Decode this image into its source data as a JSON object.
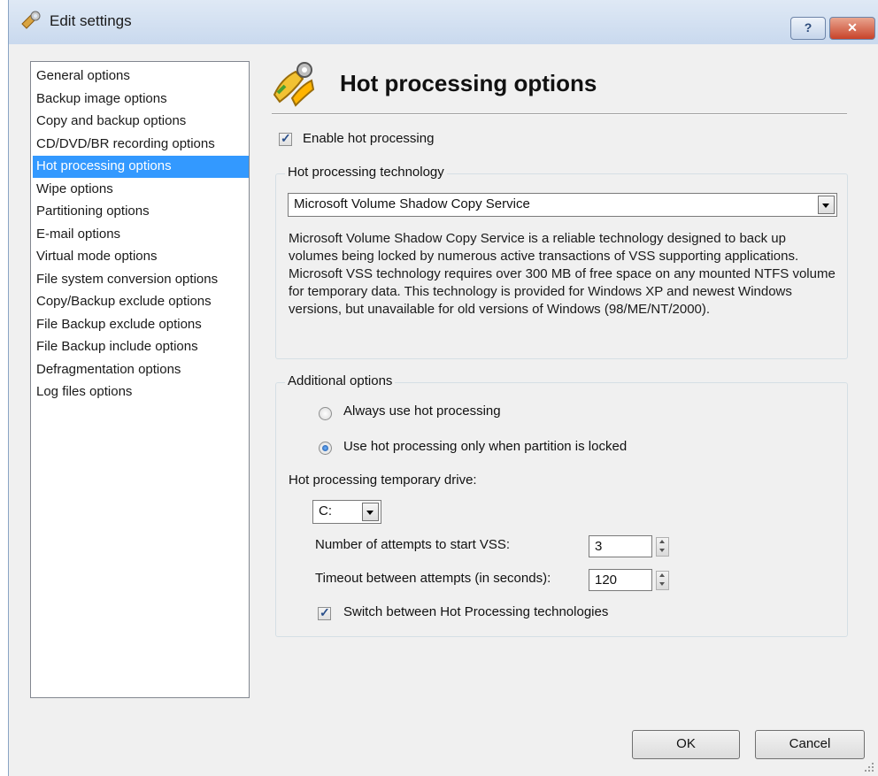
{
  "window": {
    "title": "Edit settings",
    "help_label": "?",
    "close_label": "✕"
  },
  "sidebar": {
    "items": [
      {
        "label": "General options"
      },
      {
        "label": "Backup image options"
      },
      {
        "label": "Copy and backup options"
      },
      {
        "label": "CD/DVD/BR recording options"
      },
      {
        "label": "Hot processing options",
        "selected": true
      },
      {
        "label": "Wipe options"
      },
      {
        "label": "Partitioning options"
      },
      {
        "label": "E-mail options"
      },
      {
        "label": "Virtual mode options"
      },
      {
        "label": "File system conversion options"
      },
      {
        "label": "Copy/Backup exclude options"
      },
      {
        "label": "File Backup exclude options"
      },
      {
        "label": "File Backup include options"
      },
      {
        "label": "Defragmentation options"
      },
      {
        "label": "Log files options"
      }
    ]
  },
  "panel": {
    "title": "Hot processing options",
    "enable_label": "Enable hot processing",
    "enable_checked": true,
    "technology": {
      "group_label": "Hot processing technology",
      "selected": "Microsoft Volume Shadow Copy Service",
      "description": "Microsoft Volume Shadow Copy Service is a reliable technology designed to back up volumes being locked by numerous active transactions of VSS supporting applications. Microsoft VSS technology requires over 300 MB of free space on any mounted NTFS volume for temporary data. This technology is provided for Windows XP and newest Windows versions, but unavailable for old versions of Windows (98/ME/NT/2000)."
    },
    "additional": {
      "group_label": "Additional options",
      "radio_always": "Always use hot processing",
      "radio_locked": "Use hot processing only when partition is locked",
      "selected_radio": "locked",
      "temp_drive_label": "Hot processing temporary drive:",
      "temp_drive_value": "C:",
      "attempts_label": "Number of attempts to start VSS:",
      "attempts_value": "3",
      "timeout_label": "Timeout between attempts (in seconds):",
      "timeout_value": "120",
      "switch_label": "Switch between Hot Processing technologies",
      "switch_checked": true
    }
  },
  "footer": {
    "ok_label": "OK",
    "cancel_label": "Cancel"
  }
}
